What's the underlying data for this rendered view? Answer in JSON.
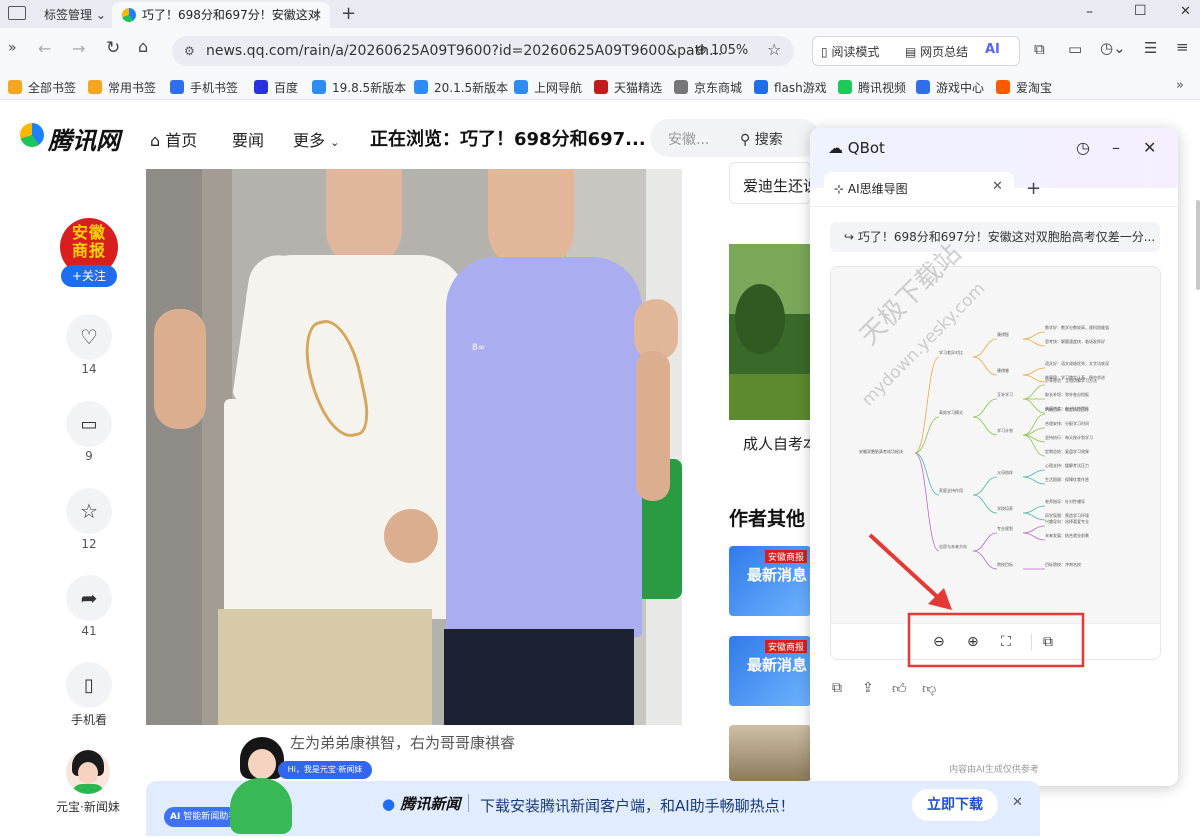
{
  "browser": {
    "bookmark_manager_label": "标签管理",
    "active_tab_title": "巧了！698分和697分！安徽这对",
    "new_tab_symbol": "+",
    "url": "news.qq.com/rain/a/20260625A09T9600?id=20260625A09T9600&path...",
    "zoom": "105%",
    "reading_mode": "阅读模式",
    "page_summary": "网页总结",
    "ai_label": "AI",
    "window_controls": [
      "–",
      "☐",
      "✕"
    ]
  },
  "bookmarks": [
    {
      "label": "全部书签",
      "icon": "star-icon",
      "color": "#f5a623"
    },
    {
      "label": "常用书签",
      "icon": "bookmark-icon",
      "color": "#f5a623"
    },
    {
      "label": "手机书签",
      "icon": "phone-icon",
      "color": "#2f6fec"
    },
    {
      "label": "百度",
      "icon": "baidu-icon",
      "color": "#2932e1"
    },
    {
      "label": "19.8.5新版本",
      "icon": "qq-browser-icon",
      "color": "#2f8cf2"
    },
    {
      "label": "20.1.5新版本",
      "icon": "qq-browser-icon",
      "color": "#2f8cf2"
    },
    {
      "label": "上网导航",
      "icon": "qq-browser-icon",
      "color": "#2f8cf2"
    },
    {
      "label": "天猫精选",
      "icon": "tmall-icon",
      "color": "#c21b1b"
    },
    {
      "label": "京东商城",
      "icon": "jd-icon",
      "color": "#777777"
    },
    {
      "label": "flash游戏",
      "icon": "flash-icon",
      "color": "#1e6fe8"
    },
    {
      "label": "腾讯视频",
      "icon": "video-icon",
      "color": "#1ec85a"
    },
    {
      "label": "游戏中心",
      "icon": "game-icon",
      "color": "#2f6fec"
    },
    {
      "label": "爱淘宝",
      "icon": "taobao-icon",
      "color": "#ff5a00"
    }
  ],
  "site": {
    "logo_text": "腾讯网",
    "nav": {
      "home": "首页",
      "news": "要闻",
      "more": "更多"
    },
    "now_browsing": "正在浏览：巧了！698分和697...",
    "search_placeholder": "安徽...",
    "search_button": "搜索"
  },
  "sidebar": {
    "author_badge": "安徽商报",
    "follow": "+关注",
    "likes": "14",
    "comments": "9",
    "favorites": "12",
    "shares": "41",
    "mobile": "手机看",
    "assistant_name": "元宝·新闻妹"
  },
  "article": {
    "caption": "左为弟弟康祺智，右为哥哥康祺睿",
    "shirt_text": "8∞ "
  },
  "right_column": {
    "related_1": "爱迪生还说",
    "related_2": "成人自考本",
    "author_other": "作者其他",
    "news_tile_tag": "安徽商报",
    "news_tile_label": "最新消息"
  },
  "qbot": {
    "title": "QBot",
    "tab_label": "AI思维导图",
    "source_title": "巧了！698分和697分！安徽这对双胞胎高考仅差一分...",
    "watermark_1": "天极下载站",
    "watermark_2": "mydown.yesky.com",
    "footer_note": "内容由AI生成仅供参考",
    "mindmap": {
      "root": "安徽双胞胎高考成功秘诀",
      "branches": [
        {
          "label": "学习差异对比",
          "children": [
            {
              "label": "康祺智",
              "leaves": [
                "数学好：数学分数较高，理科思维强",
                "思考快：解题速度快，临场发挥好"
              ]
            },
            {
              "label": "康祺睿",
              "leaves": [
                "语文好：语文成绩优秀，文字功底深",
                "做事稳：学习踏实认真，稳中求进"
              ]
            }
          ]
        },
        {
          "label": "高效学习模式",
          "children": [
            {
              "label": "互补学习",
              "leaves": [
                "分享经验：互相讲解学习方法",
                "取长补短：弥补各自短板",
                "共同进步：在对比中提升"
              ]
            },
            {
              "label": "学习计划",
              "leaves": [
                "明确目标：制定阶段目标",
                "合理安排：分配学习时间",
                "坚持执行：每天按计划学习",
                "定期总结：复盘学习效果"
              ]
            }
          ]
        },
        {
          "label": "家庭支持作用",
          "children": [
            {
              "label": "父母陪伴",
              "leaves": [
                "心理支持：缓解考试压力",
                "生活照顾：保障饮食作息"
              ]
            },
            {
              "label": "学校培养",
              "leaves": [
                "老师指导：针对性辅导",
                "同学氛围：营造学习环境"
              ]
            }
          ]
        },
        {
          "label": "志愿与未来方向",
          "children": [
            {
              "label": "专业规划",
              "leaves": [
                "兴趣导向：选择喜爱专业",
                "未来发展：结合就业前景"
              ]
            },
            {
              "label": "院校目标",
              "leaves": [
                "目标院校：冲刺名校"
              ]
            }
          ]
        }
      ]
    }
  },
  "banner": {
    "badge_text": "智能新闻助手",
    "speech": "Hi，我是元宝·新闻妹",
    "logo_text": "腾讯新闻",
    "message": "下载安装腾讯新闻客户端，和AI助手畅聊热点！",
    "download_button": "立即下载",
    "close_symbol": "✕"
  }
}
